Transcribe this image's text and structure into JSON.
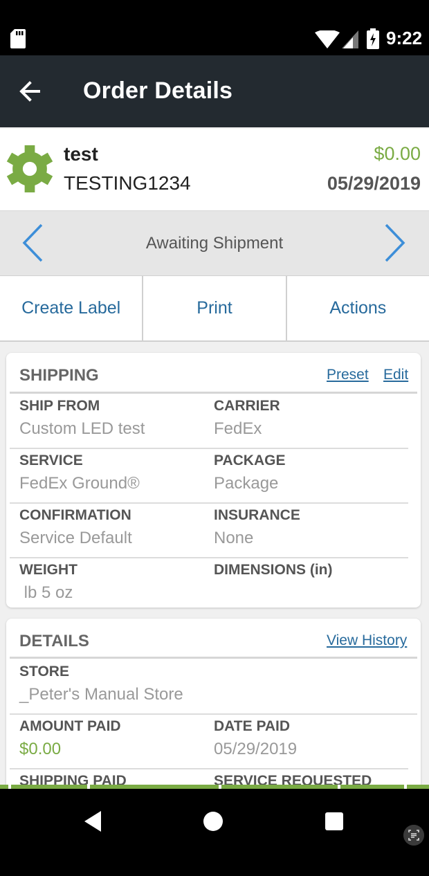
{
  "status_bar": {
    "time": "9:22"
  },
  "app_bar": {
    "title": "Order Details"
  },
  "order": {
    "name": "test",
    "number": "TESTING1234",
    "amount": "$0.00",
    "date": "05/29/2019"
  },
  "status_nav": {
    "status": "Awaiting Shipment"
  },
  "actions": {
    "create_label": "Create Label",
    "print": "Print",
    "actions": "Actions"
  },
  "shipping": {
    "title": "SHIPPING",
    "preset_link": "Preset",
    "edit_link": "Edit",
    "ship_from_label": "SHIP FROM",
    "ship_from_value": "Custom LED test",
    "carrier_label": "CARRIER",
    "carrier_value": "FedEx",
    "service_label": "SERVICE",
    "service_value": "FedEx Ground®",
    "package_label": "PACKAGE",
    "package_value": "Package",
    "confirmation_label": "CONFIRMATION",
    "confirmation_value": "Service Default",
    "insurance_label": "INSURANCE",
    "insurance_value": "None",
    "weight_label": "WEIGHT",
    "weight_value": " lb 5 oz",
    "dimensions_label": "DIMENSIONS (in)"
  },
  "details": {
    "title": "DETAILS",
    "view_history_link": "View History",
    "store_label": "STORE",
    "store_value": "_Peter's Manual Store",
    "amount_paid_label": "AMOUNT PAID",
    "amount_paid_value": "$0.00",
    "date_paid_label": "DATE PAID",
    "date_paid_value": "05/29/2019",
    "shipping_paid_label": "SHIPPING PAID",
    "service_requested_label": "SERVICE REQUESTED"
  },
  "colors": {
    "accent_green": "#7aab44",
    "link_blue": "#276a9c",
    "app_bar": "#232a30"
  }
}
